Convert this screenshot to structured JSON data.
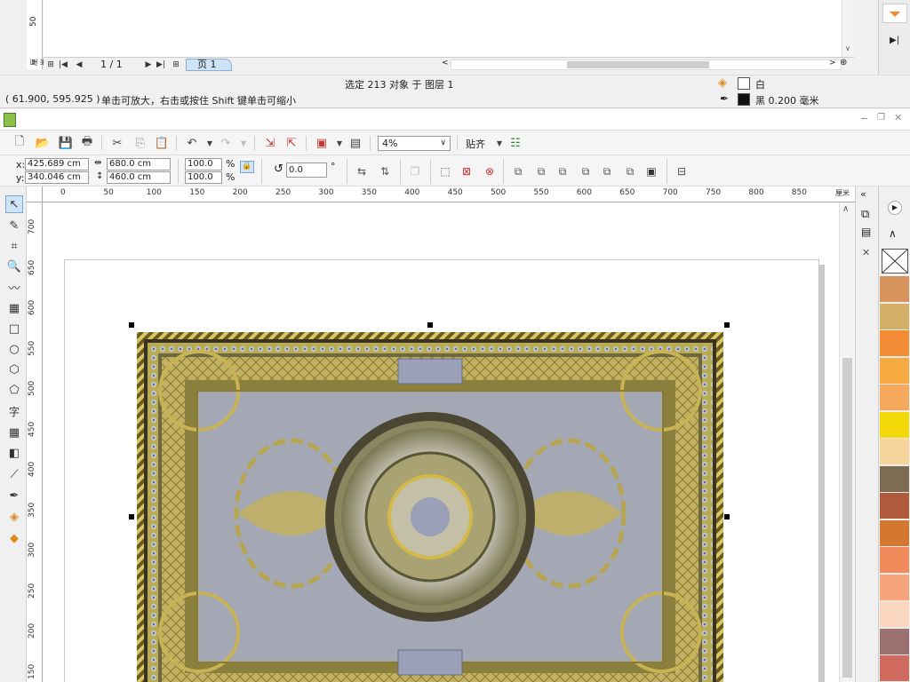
{
  "top_document": {
    "ruler_tick": "50",
    "ruler_unit": "厘米",
    "page_counter": "1 / 1",
    "page_tab": "页 1"
  },
  "status": {
    "selection": "选定 213 对象 于 图层 1",
    "coords": "( 61.900, 595.925 )",
    "hint": "单击可放大，右击或按住 Shift 键单击可缩小",
    "fill_label": "白",
    "outline_label": "黑  0.200 毫米",
    "fill_color": "#ffffff",
    "outline_color": "#000000"
  },
  "standard_toolbar": {
    "zoom_value": "4%",
    "snap_label": "贴齐"
  },
  "property_bar": {
    "x_label": "x:",
    "y_label": "y:",
    "x_value": "425.689 cm",
    "y_value": "340.046 cm",
    "width_value": "680.0 cm",
    "height_value": "460.0 cm",
    "scale_x": "100.0",
    "scale_y": "100.0",
    "percent_symbol": "%",
    "rotation_value": "0.0",
    "degree_symbol": "°"
  },
  "toolbox": {
    "text_tool_glyph": "字"
  },
  "horizontal_ruler": {
    "ticks": [
      "0",
      "50",
      "100",
      "150",
      "200",
      "250",
      "300",
      "350",
      "400",
      "450",
      "500",
      "550",
      "600",
      "650",
      "700",
      "750",
      "800",
      "850"
    ],
    "unit": "厘米"
  },
  "vertical_ruler": {
    "ticks": [
      "700",
      "650",
      "600",
      "550",
      "500",
      "450",
      "400",
      "350",
      "300",
      "250",
      "200",
      "150"
    ]
  },
  "palette": {
    "colors": [
      "#d6935c",
      "#d2b066",
      "#f28c35",
      "#f7a942",
      "#f5a95c",
      "#f4d90a",
      "#f6d49a",
      "#7e6c52",
      "#b05a3c",
      "#d4772f",
      "#f08a5a",
      "#f6a47a",
      "#fbd7bf",
      "#9c7070",
      "#d16a5e"
    ]
  },
  "icons": {
    "pick": "pick-tool-icon",
    "shape": "shape-tool-icon",
    "crop": "crop-tool-icon",
    "zoom": "zoom-tool-icon",
    "freehand": "freehand-tool-icon",
    "smartfill": "smart-fill-icon",
    "rectangle": "rectangle-tool-icon",
    "ellipse": "ellipse-tool-icon",
    "polygon": "polygon-tool-icon",
    "basic_shapes": "basic-shapes-icon",
    "table": "table-tool-icon",
    "blend": "blend-tool-icon",
    "eyedropper": "eyedropper-icon",
    "outline": "outline-pen-icon",
    "fill": "fill-bucket-icon",
    "interactive_fill": "interactive-fill-icon"
  }
}
